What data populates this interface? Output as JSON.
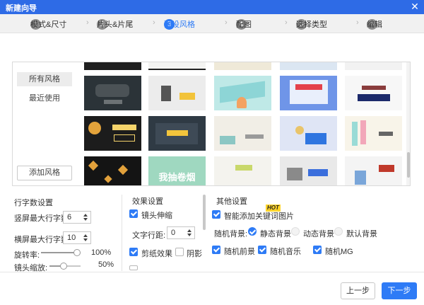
{
  "window": {
    "title": "新建向导",
    "close_glyph": "✕"
  },
  "steps": [
    {
      "num": "1",
      "label": "模式&尺寸"
    },
    {
      "num": "2",
      "label": "片头&片尾"
    },
    {
      "num": "3",
      "label": "预设风格",
      "active": true
    },
    {
      "num": "4",
      "label": "配图"
    },
    {
      "num": "5",
      "label": "选择类型"
    },
    {
      "num": "6",
      "label": "编辑"
    }
  ],
  "chevron": "›",
  "style_panel": {
    "sidebar": {
      "items": [
        "所有风格",
        "最近使用"
      ],
      "add_button": "添加风格"
    },
    "thumbnails": {
      "row1": [
        {
          "caption": ""
        },
        {
          "caption": ""
        },
        {
          "caption": ""
        },
        {
          "caption": ""
        },
        {
          "caption": ""
        }
      ],
      "row2": [
        {
          "caption": ""
        },
        {
          "caption": ""
        },
        {
          "caption": ""
        },
        {
          "caption": ""
        },
        {
          "caption": ""
        }
      ],
      "row3": [
        {
          "caption": ""
        },
        {
          "caption": "我抽卷烟"
        },
        {
          "caption": ""
        },
        {
          "caption": ""
        },
        {
          "caption": ""
        }
      ]
    }
  },
  "line_settings": {
    "title": "行字数设置",
    "portrait_label": "竖屏最大行字数",
    "portrait_value": "6",
    "landscape_label": "横屏最大行字数",
    "landscape_value": "10",
    "rotation_label": "旋转率:",
    "rotation_value": "100%",
    "rotation_level": 1.0,
    "zoom_label": "镜头缩放:",
    "zoom_value": "50%",
    "zoom_level": 0.5
  },
  "effect_settings": {
    "title": "效果设置",
    "lens_stretch": "镜头伸缩",
    "text_spacing_label": "文字行距:",
    "text_spacing_value": "0",
    "paper_cut": "剪纸效果",
    "shadow": "阴影"
  },
  "other_settings": {
    "title": "其他设置",
    "smart_keywords": "智能添加关键词图片",
    "hot_badge": "HOT",
    "random_bg_label": "随机背景:",
    "bg_options": [
      "静态背景",
      "动态背景",
      "默认背景"
    ],
    "random_foreground": "随机前景",
    "random_music": "随机音乐",
    "random_mg": "随机MG"
  },
  "footer": {
    "prev": "上一步",
    "next": "下一步"
  }
}
